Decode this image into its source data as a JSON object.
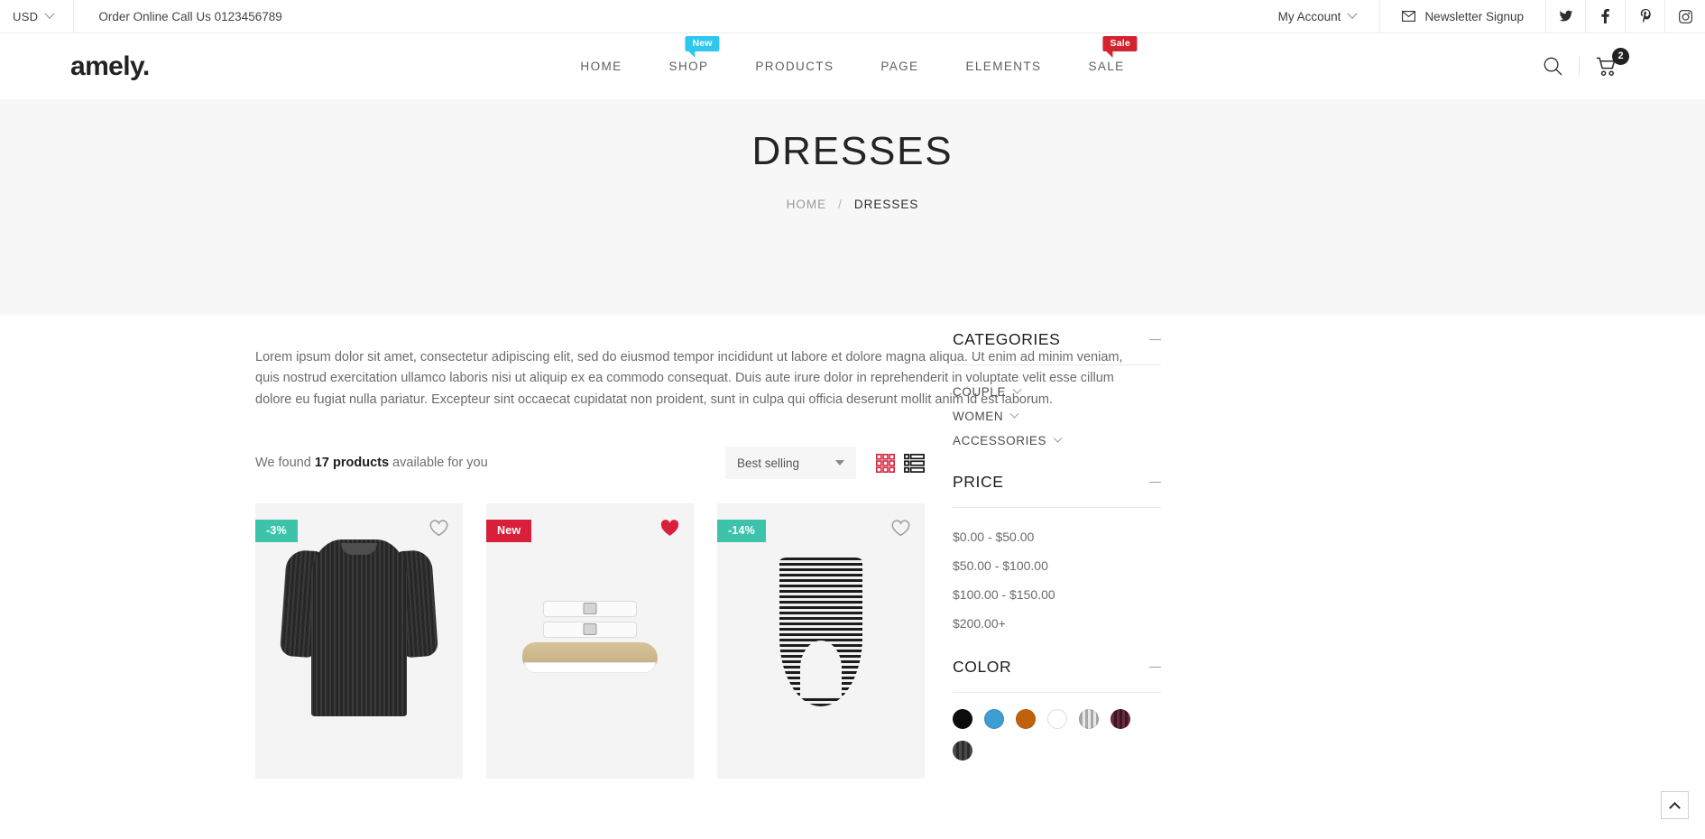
{
  "topbar": {
    "currency": "USD",
    "order_call": "Order Online Call Us 0123456789",
    "my_account": "My Account",
    "newsletter": "Newsletter Signup",
    "social": [
      "twitter",
      "facebook",
      "pinterest",
      "instagram"
    ]
  },
  "header": {
    "logo": "amely.",
    "nav": [
      {
        "label": "HOME",
        "badge": null
      },
      {
        "label": "SHOP",
        "badge": "New",
        "badge_color": "#2ec7f0"
      },
      {
        "label": "PRODUCTS",
        "badge": null
      },
      {
        "label": "PAGE",
        "badge": null
      },
      {
        "label": "ELEMENTS",
        "badge": null
      },
      {
        "label": "SALE",
        "badge": "Sale",
        "badge_color": "#d2232f"
      }
    ],
    "cart_count": "2"
  },
  "hero": {
    "title": "DRESSES",
    "breadcrumb_home": "HOME",
    "breadcrumb_sep": "/",
    "breadcrumb_current": "DRESSES"
  },
  "intro": {
    "text": "Lorem ipsum dolor sit amet, consectetur adipiscing elit, sed do eiusmod tempor incididunt ut labore et dolore magna aliqua. Ut enim ad minim veniam, quis nostrud exercitation ullamco laboris nisi ut aliquip ex ea commodo consequat. Duis aute irure dolor in reprehenderit in voluptate velit esse cillum dolore eu fugiat nulla pariatur. Excepteur sint occaecat cupidatat non proident, sunt in culpa qui officia deserunt mollit anim id est laborum."
  },
  "toolbar": {
    "found_prefix": "We found ",
    "found_count": "17 products",
    "found_suffix": " available for you",
    "sort_value": "Best selling",
    "grid_view_active": true,
    "grid_color": "#d8203a",
    "list_color": "#151515"
  },
  "products": [
    {
      "badge": "-3%",
      "badge_type": "discount",
      "badge_color": "#3ec3ab",
      "wishlisted": false,
      "kind": "dress"
    },
    {
      "badge": "New",
      "badge_type": "new",
      "badge_color": "#d8203a",
      "wishlisted": true,
      "kind": "sandal"
    },
    {
      "badge": "-14%",
      "badge_type": "discount",
      "badge_color": "#3ec3ab",
      "wishlisted": false,
      "kind": "swimsuit"
    }
  ],
  "sidebar": {
    "categories": {
      "title": "CATEGORIES",
      "items": [
        "COUPLE",
        "WOMEN",
        "ACCESSORIES"
      ]
    },
    "price": {
      "title": "PRICE",
      "ranges": [
        "$0.00 - $50.00",
        "$50.00 - $100.00",
        "$100.00 - $150.00",
        "$200.00+"
      ]
    },
    "color": {
      "title": "COLOR",
      "swatches": [
        "#0c0c0c",
        "#3d9ed1",
        "#c0620c",
        "#ffffff",
        "#8e8e8e",
        "#6b2a3c",
        "#4a4a4a"
      ]
    }
  },
  "scroll_top": "scroll-to-top"
}
